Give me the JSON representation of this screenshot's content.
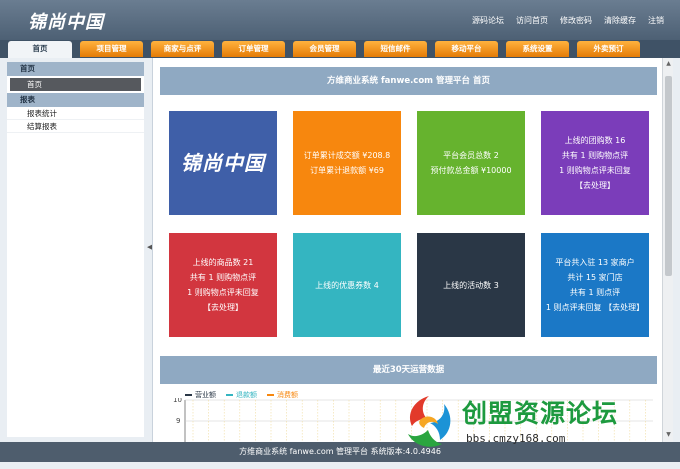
{
  "header": {
    "logo": "锦尚中国",
    "links": [
      "源码论坛",
      "访问首页",
      "修改密码",
      "清除缓存",
      "注销"
    ]
  },
  "nav": {
    "tabs": [
      "首页",
      "项目管理",
      "商家与点评",
      "订单管理",
      "会员管理",
      "短信邮件",
      "移动平台",
      "系统设置",
      "外卖预订"
    ],
    "active": "首页"
  },
  "sidebar": {
    "groups": [
      {
        "title": "首页",
        "items": [
          "首页"
        ]
      },
      {
        "title": "报表",
        "items": [
          "报表统计",
          "结算报表"
        ]
      }
    ]
  },
  "main": {
    "title": "方维商业系统 fanwe.com 管理平台 首页",
    "cards": [
      {
        "lines": [
          "锦尚中国"
        ],
        "color": "#3f5fa8"
      },
      {
        "lines": [
          "订单累计成交额 ¥208.8",
          "订单累计退款额 ¥69"
        ],
        "color": "#f7870e"
      },
      {
        "lines": [
          "平台会员总数 2",
          "预付款总金额 ¥10000"
        ],
        "color": "#66b32e"
      },
      {
        "lines": [
          "上线的团购数 16",
          "共有 1 则购物点评",
          "1 则购物点评未回复",
          "【去处理】"
        ],
        "color": "#7b3dba"
      },
      {
        "lines": [
          "上线的商品数 21",
          "共有 1 则购物点评",
          "1 则购物点评未回复",
          "【去处理】"
        ],
        "color": "#d2363f"
      },
      {
        "lines": [
          "上线的优惠券数 4"
        ],
        "color": "#34b5c1"
      },
      {
        "lines": [
          "上线的活动数 3"
        ],
        "color": "#2a3746"
      },
      {
        "lines": [
          "平台共入驻 13 家商户",
          "共计 15 家门店",
          "共有 1 则点评",
          "1 则点评未回复 【去处理】"
        ],
        "color": "#1b78c6"
      }
    ],
    "stats_title": "最近30天运营数据",
    "legend": [
      {
        "label": "营业额",
        "color": "#2a3746"
      },
      {
        "label": "退款额",
        "color": "#34b5c1"
      },
      {
        "label": "消费额",
        "color": "#f7870e"
      }
    ],
    "y_ticks": [
      "10",
      "9"
    ]
  },
  "footer": "方维商业系统 fanwe.com 管理平台 系统版本:4.0.4946",
  "watermark": {
    "title": "创盟资源论坛",
    "url": "bbs.cmzy168.com"
  }
}
